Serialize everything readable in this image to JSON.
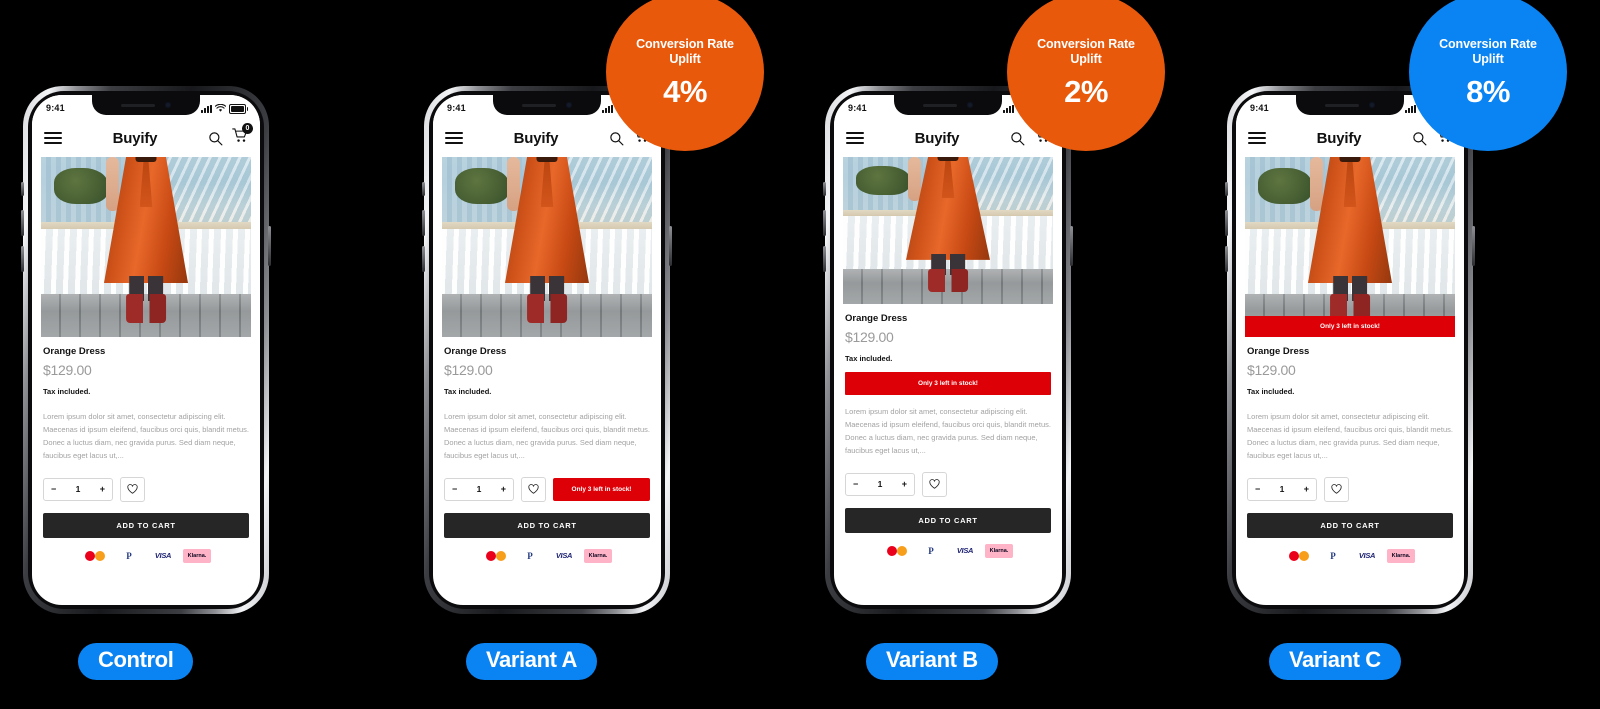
{
  "page": {
    "background": "#000000",
    "accent_blue": "#0b84f3",
    "accent_orange": "#e8590c",
    "stock_red": "#dd0007"
  },
  "phone_ui": {
    "status_time": "9:41",
    "brand": "Buyify",
    "cart_count": "0",
    "icons": {
      "menu": "hamburger-icon",
      "search": "search-icon",
      "cart": "cart-icon",
      "heart": "heart-icon",
      "minus": "−",
      "plus": "+"
    },
    "product": {
      "title": "Orange Dress",
      "price": "$129.00",
      "tax": "Tax included.",
      "description": "Lorem ipsum dolor sit amet, consectetur adipiscing elit. Maecenas id ipsum eleifend, faucibus orci quis, blandit metus. Donec a luctus diam, nec gravida purus. Sed diam neque, faucibus eget lacus ut,...",
      "quantity": "1",
      "add_to_cart": "ADD TO CART",
      "stock_message": "Only 3 left in stock!"
    },
    "payment_methods": [
      "mastercard",
      "PayPal",
      "VISA",
      "Klarna."
    ]
  },
  "columns": [
    {
      "id": "control",
      "pill_label": "Control",
      "stock_placement": "none",
      "uplift": null
    },
    {
      "id": "variant-a",
      "pill_label": "Variant A",
      "stock_placement": "inline-qty-row",
      "uplift": {
        "label_line1": "Conversion Rate",
        "label_line2": "Uplift",
        "value": "4%",
        "color": "#e8590c"
      }
    },
    {
      "id": "variant-b",
      "pill_label": "Variant B",
      "stock_placement": "below-tax-full-width",
      "uplift": {
        "label_line1": "Conversion Rate",
        "label_line2": "Uplift",
        "value": "2%",
        "color": "#e8590c"
      }
    },
    {
      "id": "variant-c",
      "pill_label": "Variant C",
      "stock_placement": "image-overlay",
      "uplift": {
        "label_line1": "Conversion Rate",
        "label_line2": "Uplift",
        "value": "8%",
        "color": "#0b84f3"
      }
    }
  ]
}
